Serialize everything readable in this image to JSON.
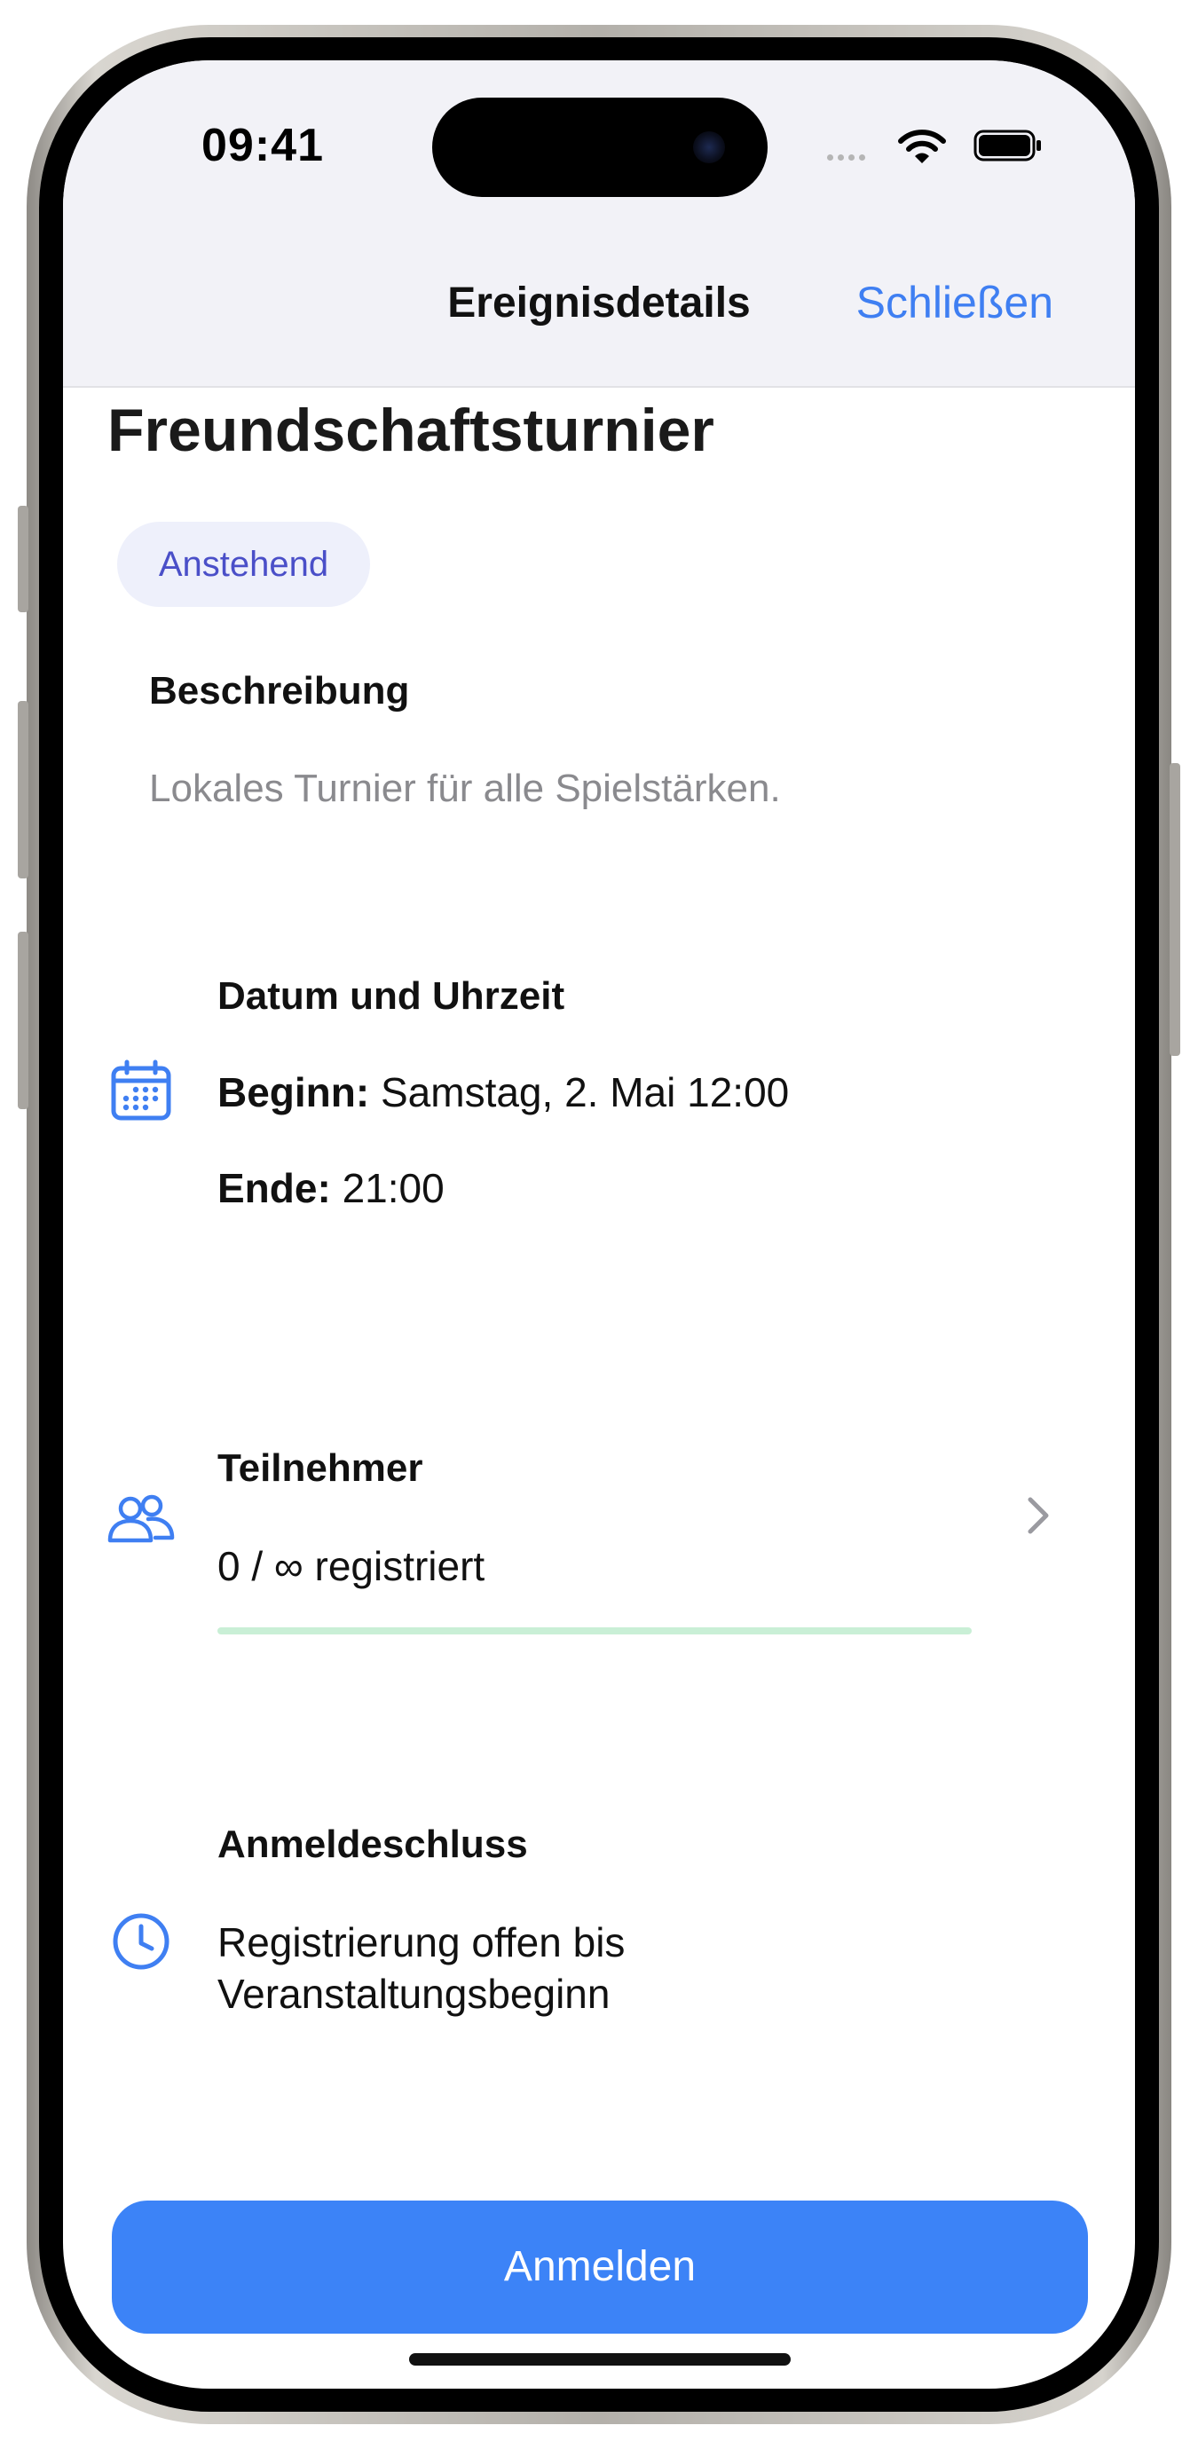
{
  "status_bar": {
    "time": "09:41"
  },
  "nav": {
    "title": "Ereignisdetails",
    "close_label": "Schließen"
  },
  "event": {
    "title": "Freundschaftsturnier",
    "status_badge": "Anstehend",
    "description_heading": "Beschreibung",
    "description_text": "Lokales Turnier für alle Spielstärken.",
    "datetime": {
      "heading": "Datum und Uhrzeit",
      "start_label": "Beginn:",
      "start_value": "Samstag, 2. Mai 12:00",
      "end_label": "Ende:",
      "end_value": "21:00",
      "icon": "calendar-icon"
    },
    "participants": {
      "heading": "Teilnehmer",
      "count_text": "0 / ∞ registriert",
      "progress": 0,
      "icon": "people-icon"
    },
    "deadline": {
      "heading": "Anmeldeschluss",
      "line1": "Registrierung offen bis",
      "line2": "Veranstaltungsbeginn",
      "icon": "clock-icon"
    }
  },
  "actions": {
    "register_label": "Anmelden"
  },
  "colors": {
    "accent": "#3c83f7",
    "badge_bg": "#eef0fb",
    "badge_text": "#4a4fc8",
    "progress_track": "#c9efd6"
  }
}
